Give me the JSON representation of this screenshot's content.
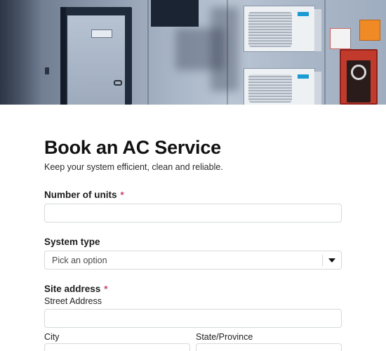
{
  "hero": {
    "alt_icon": "building-wall-with-ac-units-image"
  },
  "form": {
    "title": "Book an AC Service",
    "subtitle": "Keep your system efficient, clean and reliable.",
    "units": {
      "label": "Number of units",
      "required_mark": "*",
      "value": ""
    },
    "system_type": {
      "label": "System type",
      "placeholder": "Pick an option"
    },
    "site_address": {
      "label": "Site address",
      "required_mark": "*",
      "street_label": "Street Address",
      "street_value": "",
      "city_label": "City",
      "city_value": "",
      "state_label": "State/Province",
      "state_value": ""
    }
  },
  "colors": {
    "required": "#d6336c",
    "border": "#d6d9de",
    "title": "#111111"
  }
}
